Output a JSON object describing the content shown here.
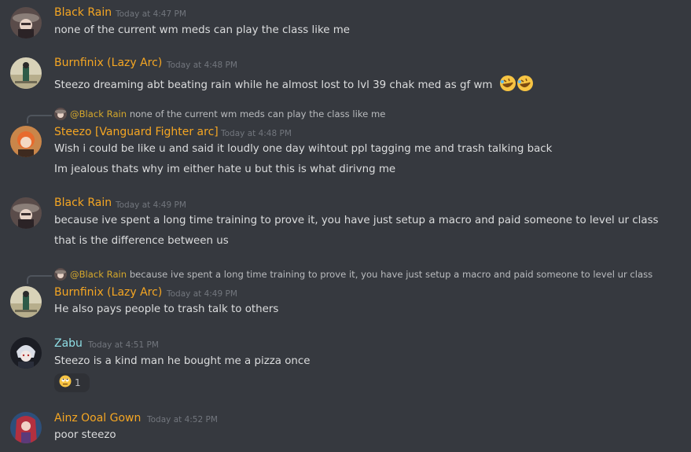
{
  "colors": {
    "background": "#36393f",
    "username_gold": "#f5a623",
    "username_teal": "#8fdfe6",
    "message_text": "#dcddde",
    "timestamp": "#72767d"
  },
  "messages": [
    {
      "author": "Black Rain",
      "timestamp": "Today at 4:47 PM",
      "lines": [
        "none of the current wm meds can play the class like me"
      ]
    },
    {
      "author": "Burnfinix (Lazy Arc)",
      "timestamp": "Today at 4:48 PM",
      "lines": [
        "Steezo dreaming abt beating rain while he almost lost to lvl 39 chak med as gf wm"
      ],
      "emojis": [
        "rofl-emoji",
        "rofl-emoji"
      ]
    },
    {
      "reply": {
        "author": "@Black Rain",
        "text": "none of the current wm meds can play the class like me"
      },
      "author": "Steezo [Vanguard Fighter arc]",
      "timestamp": "Today at 4:48 PM",
      "lines": [
        "Wish i could be like u and said it loudly one day wihtout ppl tagging me and trash talking back",
        "Im jealous thats why im either hate u but this is what dirivng me"
      ]
    },
    {
      "author": "Black Rain",
      "timestamp": "Today at 4:49 PM",
      "lines": [
        "because ive spent a long time training to prove it, you have just setup a macro and paid someone to level ur class",
        "that is the difference between us"
      ]
    },
    {
      "reply": {
        "author": "@Black Rain",
        "text": "because ive spent a long time training to prove it, you have just setup a macro and paid someone to level ur class"
      },
      "author": "Burnfinix (Lazy Arc)",
      "timestamp": "Today at 4:49 PM",
      "lines": [
        "He also pays people to trash talk to others"
      ]
    },
    {
      "author": "Zabu",
      "timestamp": "Today at 4:51 PM",
      "lines": [
        "Steezo is a kind man he bought me a pizza once"
      ],
      "reaction": {
        "emoji": "rolling-eyes-emoji",
        "count": "1"
      }
    },
    {
      "author": "Ainz Ooal Gown",
      "timestamp": "Today at 4:52 PM",
      "lines": [
        "poor steezo"
      ]
    }
  ]
}
